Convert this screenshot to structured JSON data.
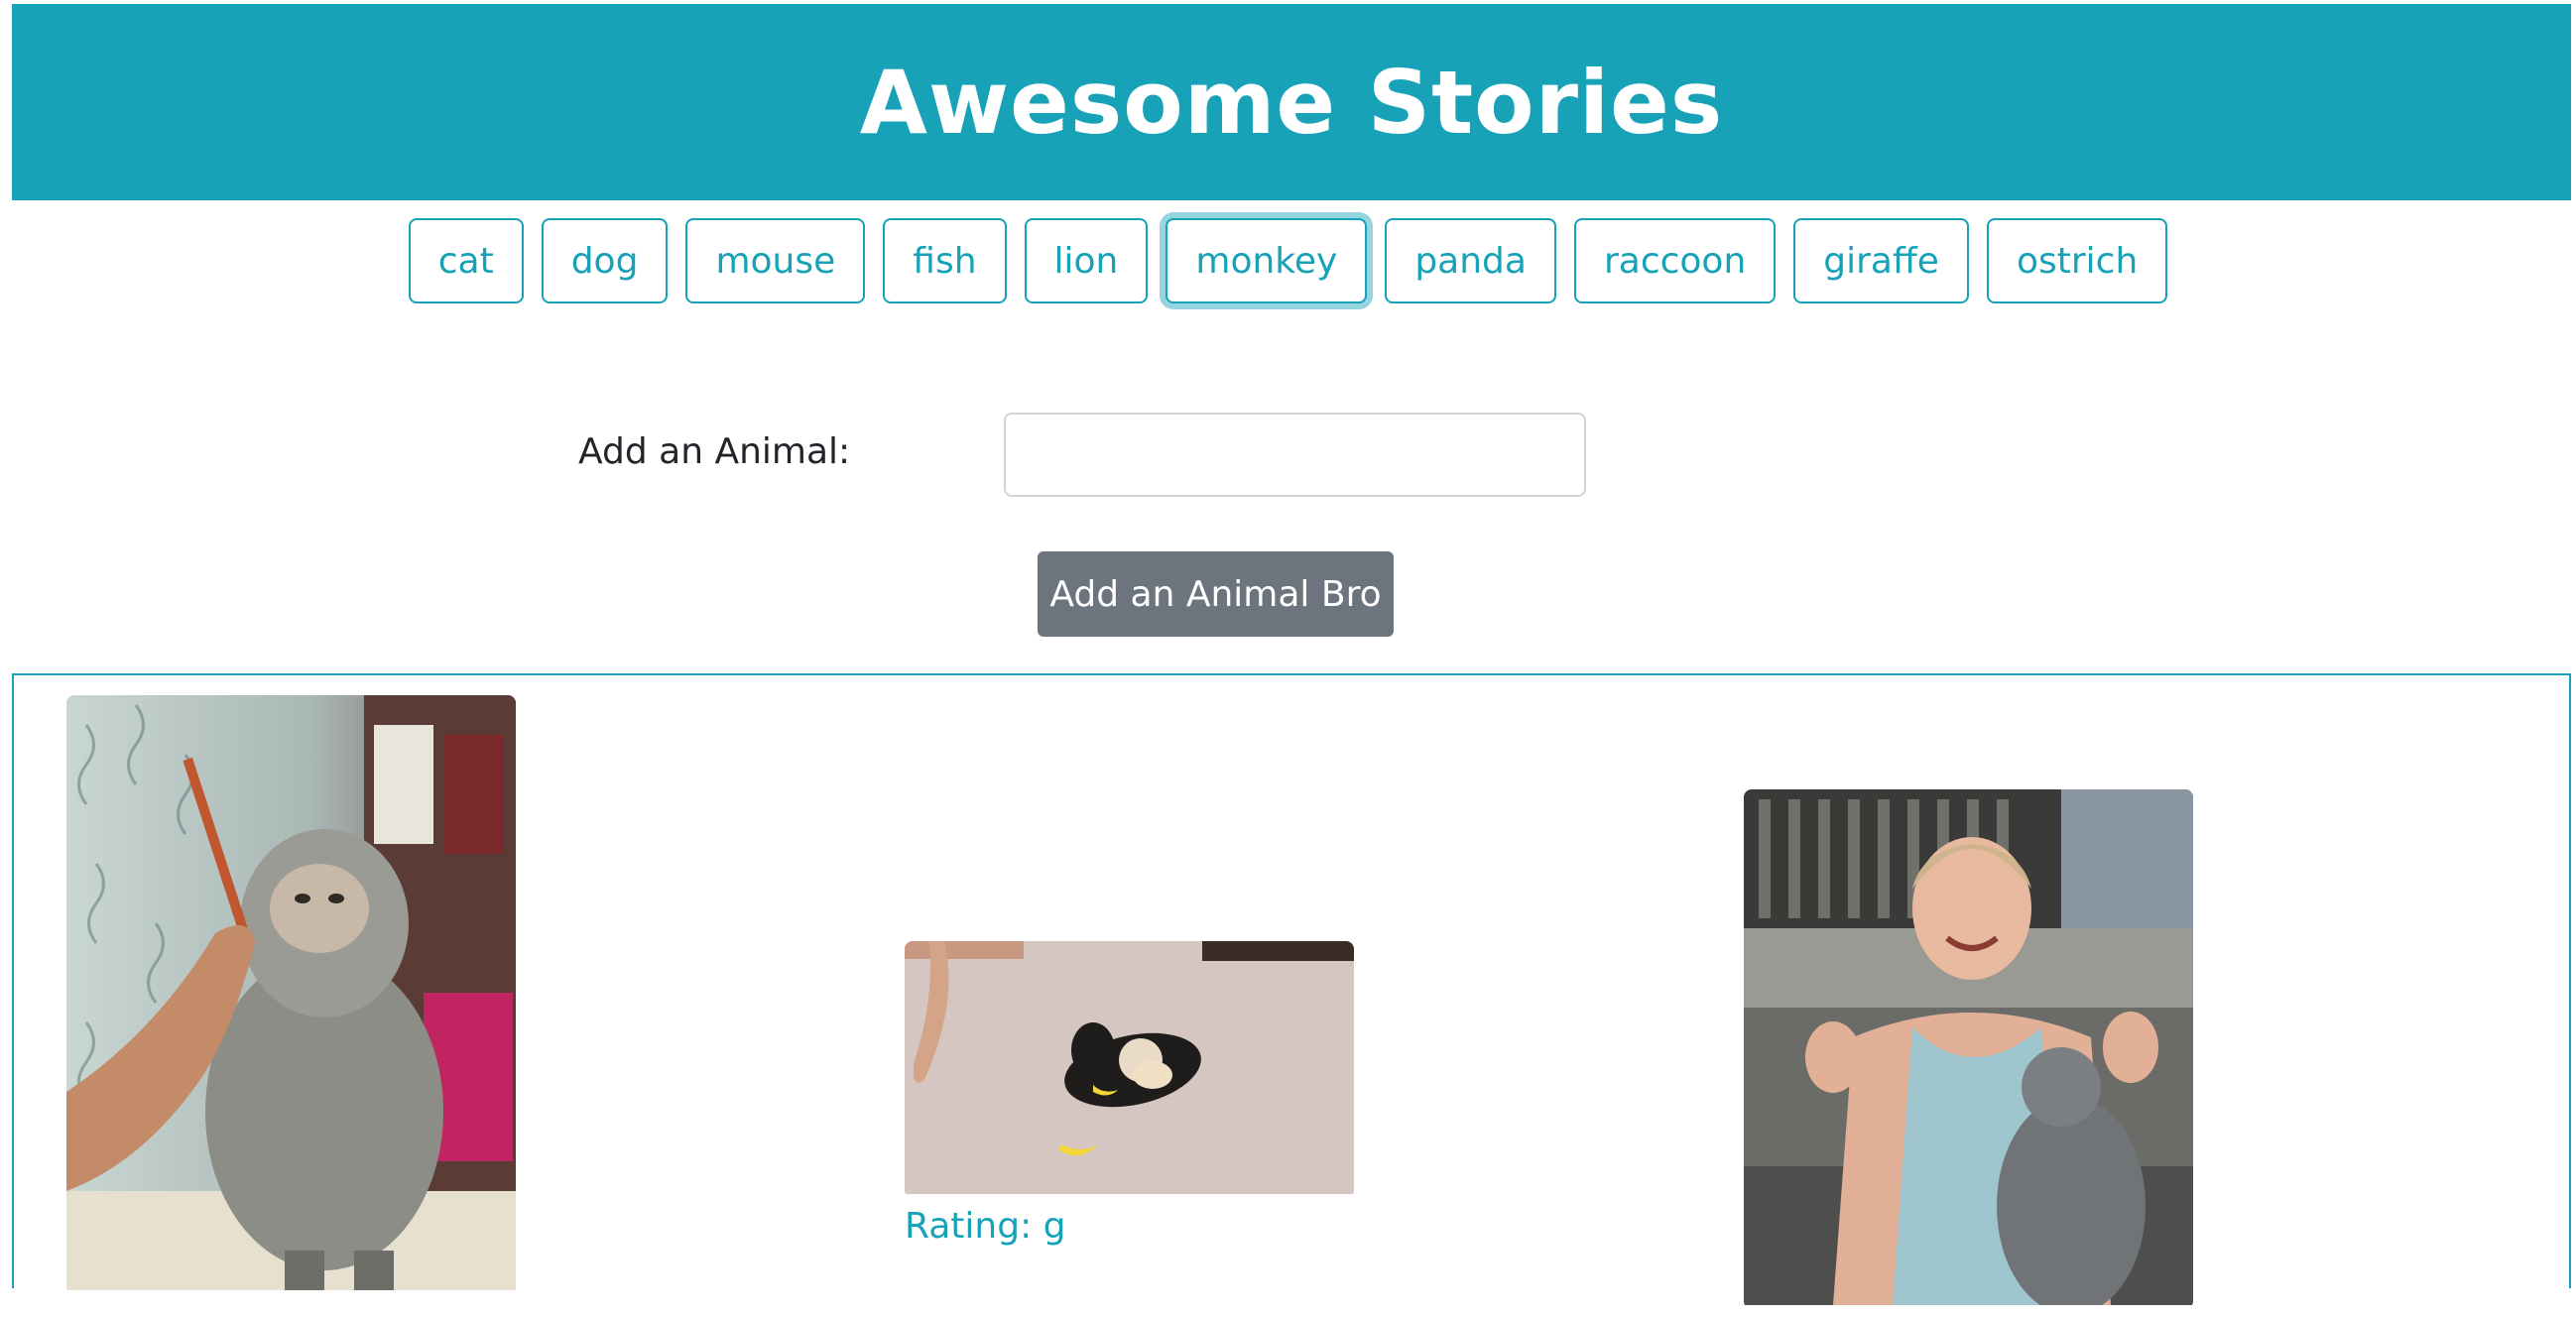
{
  "header": {
    "title": "Awesome Stories"
  },
  "animals": {
    "buttons": [
      "cat",
      "dog",
      "mouse",
      "fish",
      "lion",
      "monkey",
      "panda",
      "raccoon",
      "giraffe",
      "ostrich"
    ],
    "active": "monkey"
  },
  "add_form": {
    "label": "Add an Animal:",
    "input_value": "",
    "submit_label": "Add an Animal Bro"
  },
  "results": {
    "gifs": [
      {
        "rating": ""
      },
      {
        "rating": "Rating: g"
      },
      {
        "rating": ""
      }
    ]
  },
  "colors": {
    "accent": "#17a2b8",
    "secondary_button": "#6c757d"
  }
}
